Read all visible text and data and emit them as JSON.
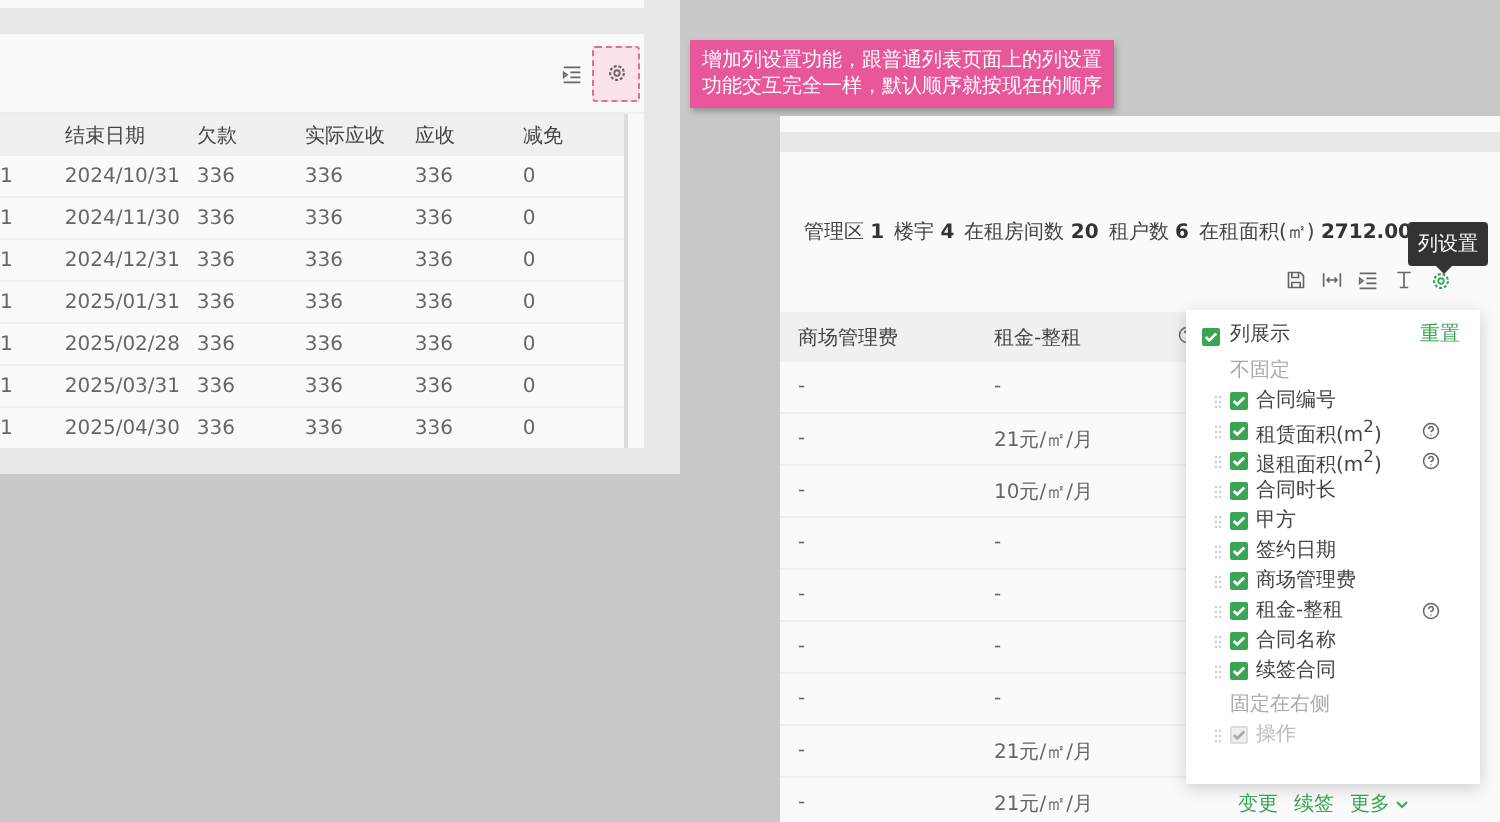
{
  "annotation": {
    "text": "增加列设置功能，跟普通列表页面上的列设置功能交互完全一样，默认顺序就按现在的顺序"
  },
  "left_panel": {
    "table": {
      "columns": [
        "结束日期",
        "欠款",
        "实际应收",
        "应收",
        "减免"
      ],
      "rows": [
        {
          "column_1": "1",
          "cells": [
            "2024/10/31",
            "336",
            "336",
            "336",
            "0"
          ]
        },
        {
          "column_1": "1",
          "cells": [
            "2024/11/30",
            "336",
            "336",
            "336",
            "0"
          ]
        },
        {
          "column_1": "1",
          "cells": [
            "2024/12/31",
            "336",
            "336",
            "336",
            "0"
          ]
        },
        {
          "column_1": "1",
          "cells": [
            "2025/01/31",
            "336",
            "336",
            "336",
            "0"
          ]
        },
        {
          "column_1": "1",
          "cells": [
            "2025/02/28",
            "336",
            "336",
            "336",
            "0"
          ]
        },
        {
          "column_1": "1",
          "cells": [
            "2025/03/31",
            "336",
            "336",
            "336",
            "0"
          ]
        },
        {
          "column_1": "1",
          "cells": [
            "2025/04/30",
            "336",
            "336",
            "336",
            "0"
          ]
        }
      ]
    }
  },
  "right_panel": {
    "stats": [
      {
        "label": "管理区",
        "value": "1"
      },
      {
        "label": "楼宇",
        "value": "4"
      },
      {
        "label": "在租房间数",
        "value": "20"
      },
      {
        "label": "租户数",
        "value": "6"
      },
      {
        "label": "在租面积(㎡)",
        "value": "2712.00"
      }
    ],
    "tooltip": "列设置",
    "table": {
      "columns": [
        "商场管理费",
        "租金-整租"
      ],
      "rows": [
        {
          "cells": [
            "-",
            "-"
          ]
        },
        {
          "cells": [
            "-",
            "21元/㎡/月"
          ]
        },
        {
          "cells": [
            "-",
            "10元/㎡/月"
          ]
        },
        {
          "cells": [
            "-",
            "-"
          ]
        },
        {
          "cells": [
            "-",
            "-"
          ]
        },
        {
          "cells": [
            "-",
            "-"
          ]
        },
        {
          "cells": [
            "-",
            "-"
          ]
        },
        {
          "cells": [
            "-",
            "21元/㎡/月"
          ]
        },
        {
          "cells": [
            "-",
            "21元/㎡/月"
          ],
          "actions": [
            "变更",
            "续签",
            "更多"
          ]
        }
      ]
    },
    "column_settings": {
      "title": "列展示",
      "checked": true,
      "reset": "重置",
      "groups": [
        {
          "label": "不固定",
          "items": [
            {
              "label": "合同编号",
              "checked": true,
              "disabled": false,
              "help": false
            },
            {
              "label": "租赁面积(m$^{2}$)",
              "checked": true,
              "disabled": false,
              "help": true
            },
            {
              "label": "退租面积(m$^{2}$)",
              "checked": true,
              "disabled": false,
              "help": true
            },
            {
              "label": "合同时长",
              "checked": true,
              "disabled": false,
              "help": false
            },
            {
              "label": "甲方",
              "checked": true,
              "disabled": false,
              "help": false
            },
            {
              "label": "签约日期",
              "checked": true,
              "disabled": false,
              "help": false
            },
            {
              "label": "商场管理费",
              "checked": true,
              "disabled": false,
              "help": false
            },
            {
              "label": "租金-整租",
              "checked": true,
              "disabled": false,
              "help": true
            },
            {
              "label": "合同名称",
              "checked": true,
              "disabled": false,
              "help": false
            },
            {
              "label": "续签合同",
              "checked": true,
              "disabled": false,
              "help": false
            }
          ]
        },
        {
          "label": "固定在右侧",
          "items": [
            {
              "label": "操作",
              "checked": true,
              "disabled": true,
              "help": false
            }
          ]
        }
      ]
    }
  }
}
